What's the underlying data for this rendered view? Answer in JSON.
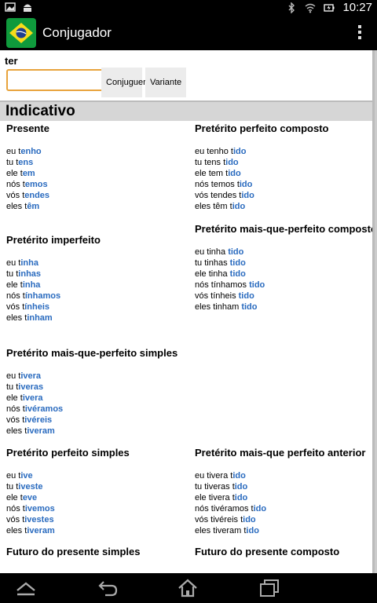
{
  "status_bar": {
    "time": "10:27"
  },
  "app": {
    "title": "Conjugador",
    "icon_colors": {
      "green": "#0f9a3c",
      "yellow": "#f6dc1a",
      "blue": "#1f3f8f"
    }
  },
  "input": {
    "label": "ter",
    "value": "",
    "placeholder": ""
  },
  "buttons": {
    "conjugate": "Conjuguer",
    "variant": "Variante"
  },
  "section": "Indicativo",
  "colors": {
    "ending": "#2a6bbf"
  },
  "tenses": [
    {
      "name": "Presente",
      "rows": [
        [
          "eu ",
          "t",
          "enho"
        ],
        [
          "tu ",
          "t",
          "ens"
        ],
        [
          "ele ",
          "t",
          "em"
        ],
        [
          "nós ",
          "t",
          "emos"
        ],
        [
          "vós ",
          "t",
          "endes"
        ],
        [
          "eles ",
          "t",
          "êm"
        ]
      ]
    },
    {
      "name": "Pretérito perfeito composto",
      "rows": [
        [
          "eu tenho ",
          "t",
          "ido"
        ],
        [
          "tu tens ",
          "t",
          "ido"
        ],
        [
          "ele tem ",
          "t",
          "ido"
        ],
        [
          "nós temos ",
          "t",
          "ido"
        ],
        [
          "vós tendes ",
          "t",
          "ido"
        ],
        [
          "eles têm ",
          "t",
          "ido"
        ]
      ]
    },
    {
      "name": "Pretérito imperfeito",
      "rows": [
        [
          "eu ",
          "t",
          "inha"
        ],
        [
          "tu ",
          "t",
          "inhas"
        ],
        [
          "ele ",
          "t",
          "inha"
        ],
        [
          "nós ",
          "t",
          "ínhamos"
        ],
        [
          "vós ",
          "t",
          "ínheis"
        ],
        [
          "eles ",
          "t",
          "inham"
        ]
      ]
    },
    {
      "name": "Pretérito mais-que-perfeito composto",
      "rows": [
        [
          "eu tinha ",
          "",
          "tido"
        ],
        [
          "tu tinhas ",
          "",
          "tido"
        ],
        [
          "ele tinha ",
          "",
          "tido"
        ],
        [
          "nós tínhamos ",
          "",
          "tido"
        ],
        [
          "vós tínheis ",
          "",
          "tido"
        ],
        [
          "eles tinham ",
          "",
          "tido"
        ]
      ]
    },
    {
      "name": "Pretérito mais-que-perfeito simples",
      "rows": [
        [
          "eu ",
          "t",
          "ivera"
        ],
        [
          "tu ",
          "t",
          "iveras"
        ],
        [
          "ele ",
          "t",
          "ivera"
        ],
        [
          "nós ",
          "t",
          "ivéramos"
        ],
        [
          "vós ",
          "t",
          "ivéreis"
        ],
        [
          "eles ",
          "t",
          "iveram"
        ]
      ]
    },
    {
      "name": "Pretérito perfeito simples",
      "rows": [
        [
          "eu ",
          "t",
          "ive"
        ],
        [
          "tu ",
          "t",
          "iveste"
        ],
        [
          "ele ",
          "t",
          "eve"
        ],
        [
          "nós ",
          "t",
          "ivemos"
        ],
        [
          "vós ",
          "t",
          "ivestes"
        ],
        [
          "eles ",
          "t",
          "iveram"
        ]
      ]
    },
    {
      "name": "Pretérito mais-que perfeito anterior",
      "rows": [
        [
          "eu tivera ",
          "t",
          "ido"
        ],
        [
          "tu tiveras ",
          "t",
          "ido"
        ],
        [
          "ele tivera ",
          "t",
          "ido"
        ],
        [
          "nós tivéramos ",
          "t",
          "ido"
        ],
        [
          "vós tivéreis ",
          "t",
          "ido"
        ],
        [
          "eles tiveram ",
          "t",
          "ido"
        ]
      ]
    },
    {
      "name": "Futuro do presente simples",
      "rows": []
    },
    {
      "name": "Futuro do presente composto",
      "rows": []
    }
  ]
}
